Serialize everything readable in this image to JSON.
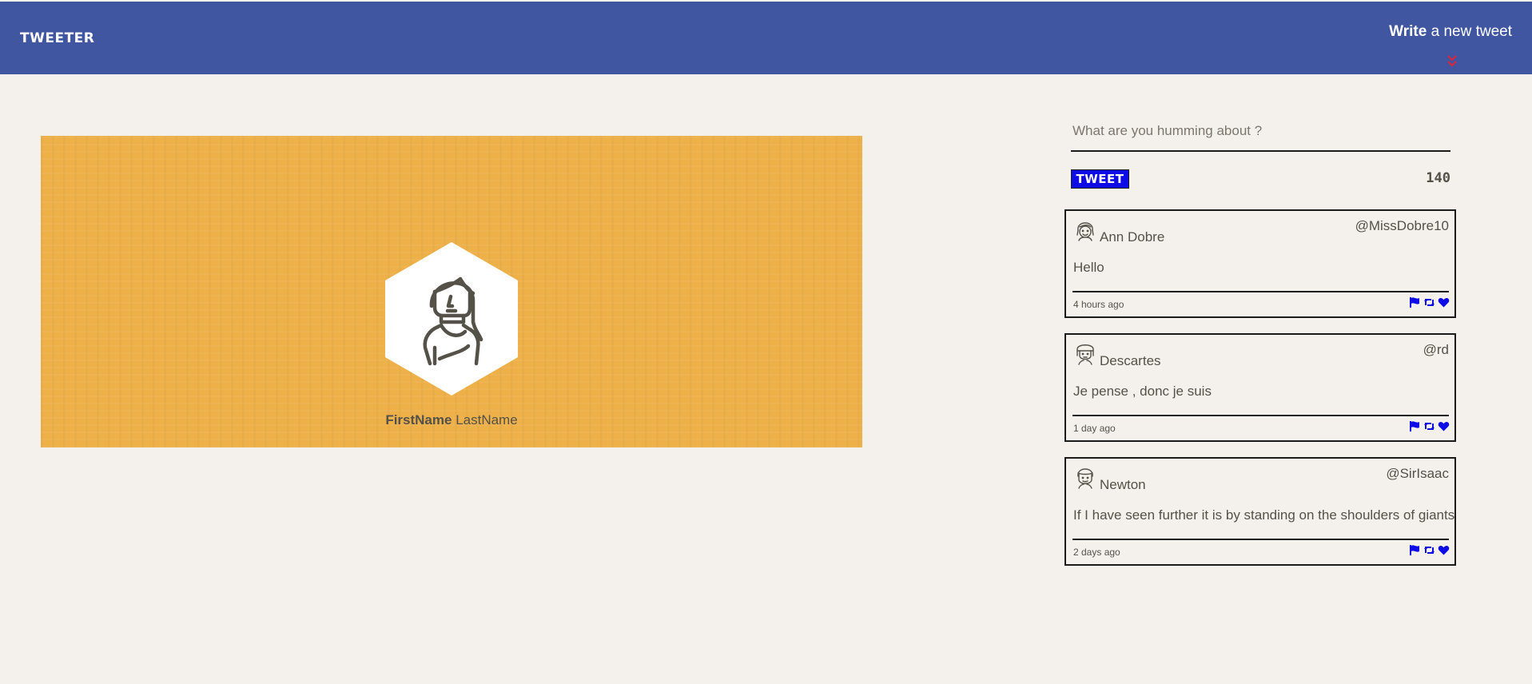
{
  "nav": {
    "brand": "TWEETER",
    "compose_bold": "Write",
    "compose_rest": " a new tweet"
  },
  "profile": {
    "first_name": "FirstName",
    "last_name": "LastName"
  },
  "composer": {
    "placeholder": "What are you humming about ?",
    "button_label": "TWEET",
    "counter": "140"
  },
  "tweets": [
    {
      "author": "Ann Dobre",
      "handle": "@MissDobre10",
      "content": "Hello",
      "time": "4 hours ago",
      "avatar_icon": "woman-avatar-icon"
    },
    {
      "author": "Descartes",
      "handle": "@rd",
      "content": "Je pense , donc je suis",
      "time": "1 day ago",
      "avatar_icon": "man-avatar-icon"
    },
    {
      "author": "Newton",
      "handle": "@SirIsaac",
      "content": "If I have seen further it is by standing on the shoulders of giants",
      "time": "2 days ago",
      "avatar_icon": "man-avatar-icon"
    }
  ],
  "colors": {
    "nav_bg": "#4056a1",
    "page_bg": "#f4f1ed",
    "profile_bg": "#eeb14a",
    "accent_blue": "#0d0ce6",
    "chevron_red": "#d7263d",
    "text": "#545149"
  }
}
